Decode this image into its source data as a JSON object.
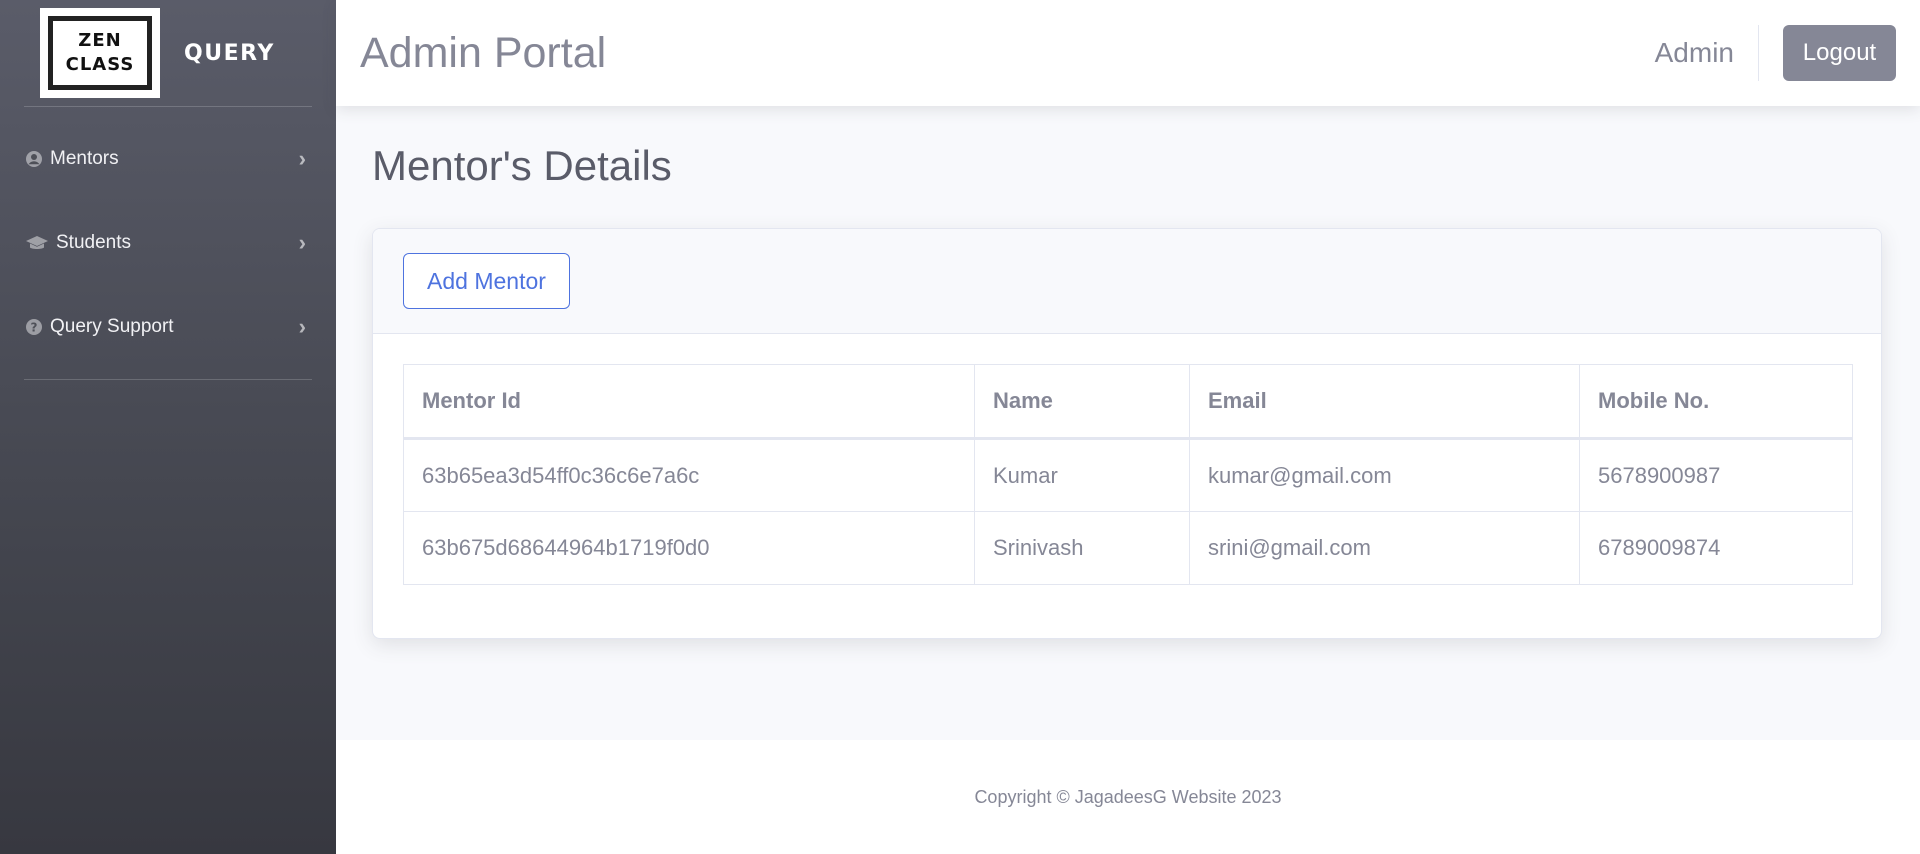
{
  "sidebar": {
    "logo_line1": "ZEN",
    "logo_line2": "CLASS",
    "brand": "QUERY",
    "items": [
      {
        "label": "Mentors",
        "icon": "user-circle-icon"
      },
      {
        "label": "Students",
        "icon": "graduation-cap-icon"
      },
      {
        "label": "Query Support",
        "icon": "question-circle-icon"
      }
    ]
  },
  "topbar": {
    "title": "Admin Portal",
    "user": "Admin",
    "logout_label": "Logout"
  },
  "main": {
    "heading": "Mentor's Details",
    "add_button": "Add Mentor",
    "table": {
      "headers": [
        "Mentor Id",
        "Name",
        "Email",
        "Mobile No."
      ],
      "rows": [
        [
          "63b65ea3d54ff0c36c6e7a6c",
          "Kumar",
          "kumar@gmail.com",
          "5678900987"
        ],
        [
          "63b675d68644964b1719f0d0",
          "Srinivash",
          "srini@gmail.com",
          "6789009874"
        ]
      ]
    }
  },
  "footer": {
    "copyright": "Copyright © JagadeesG Website 2023"
  },
  "colors": {
    "sidebar_top": "#5a5c69",
    "sidebar_bottom": "#373840",
    "primary": "#4e73df",
    "text_muted": "#858796",
    "page_bg": "#f8f9fc"
  }
}
